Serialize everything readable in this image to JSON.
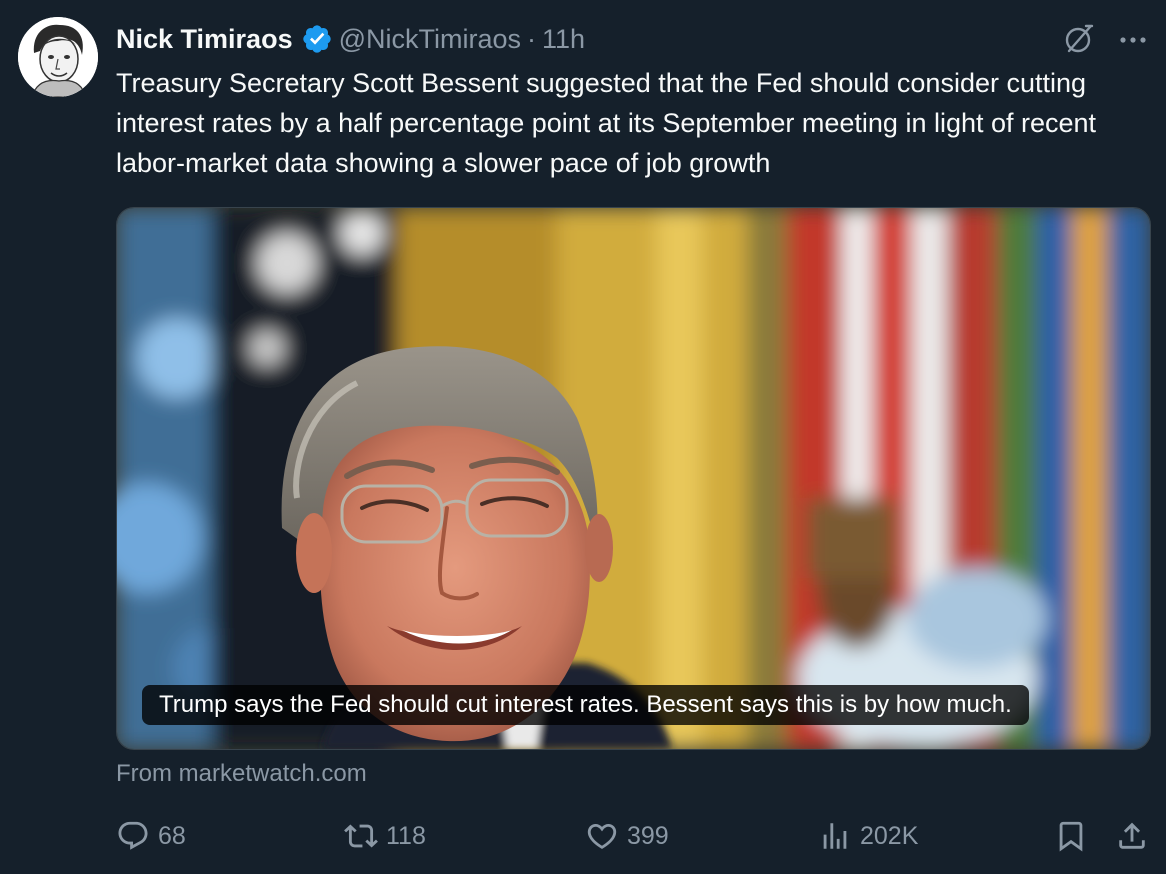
{
  "tweet": {
    "author_name": "Nick Timiraos",
    "handle": "@NickTimiraos",
    "separator": "·",
    "time": "11h",
    "text": "Treasury Secretary Scott Bessent suggested that the Fed should consider cutting interest rates by a half percentage point at its September meeting in light of recent labor-market data showing a slower pace of job growth"
  },
  "card": {
    "caption": "Trump says the Fed should cut interest rates. Bessent says this is by how much.",
    "source": "From marketwatch.com"
  },
  "actions": {
    "replies": "68",
    "reposts": "118",
    "likes": "399",
    "views": "202K"
  },
  "icons": {
    "verified": "verified-badge-icon",
    "grok": "grok-icon",
    "more": "more-icon",
    "reply": "reply-icon",
    "repost": "repost-icon",
    "like": "like-icon",
    "views": "views-icon",
    "bookmark": "bookmark-icon",
    "share": "share-icon"
  },
  "colors": {
    "background": "#15202b",
    "text": "#f7f9f9",
    "secondary": "#8b98a5",
    "verified": "#1d9bf0"
  }
}
